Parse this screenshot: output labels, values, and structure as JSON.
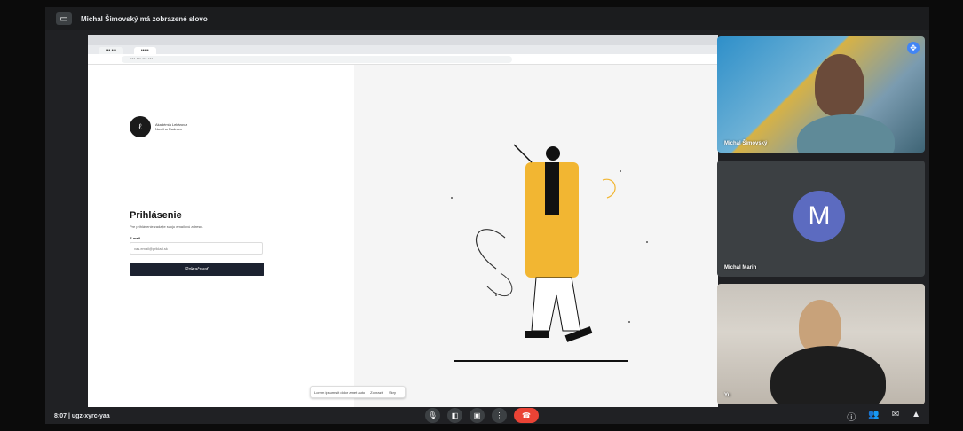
{
  "topbar": {
    "presenter_text": "Michal Šimovský má zobrazené slovo"
  },
  "browser": {
    "tab_active_label": "•••••",
    "tab_other_label": "••• •••",
    "url": "••• ••• ••• •••"
  },
  "login": {
    "logo_text": "Akadémia Lekárov z Nového Rudnom",
    "title": "Prihlásenie",
    "subtitle": "Pre prihlásenie zadajte svoju emailovú adresu.",
    "email_label": "E-mail",
    "email_placeholder": "vas.email@priklad.sk",
    "button_label": "Pokračovať"
  },
  "download_bar": {
    "text": "Lorem ipsum sit dolor amet auto",
    "button1": "Zobraziť",
    "button2": "Skry"
  },
  "participants": [
    {
      "name": "Michal Šimovský",
      "pinned": true
    },
    {
      "name": "Michal Marin",
      "avatar_letter": "M",
      "avatar_color": "#5c6bc0"
    },
    {
      "name": "Yu"
    }
  ],
  "bottombar": {
    "meeting_info": "8:07 | ugz-xyrc-yaa"
  },
  "colors": {
    "end_call": "#ea4335",
    "accent": "#4285f4",
    "coat": "#f2b632"
  }
}
